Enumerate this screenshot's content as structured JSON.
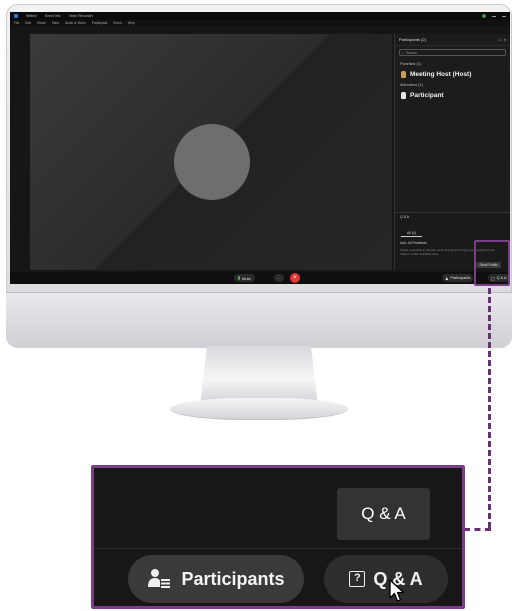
{
  "titlebar": {
    "app": "Webex",
    "tab1": "Event Info",
    "tab2": "Video Recorder"
  },
  "menubar": [
    "File",
    "Edit",
    "Share",
    "View",
    "Audio & Video",
    "Participant",
    "Event",
    "Help"
  ],
  "panel": {
    "header": "Participants (2)",
    "search_placeholder": "Search",
    "panelists_group": "Panelists (1)",
    "host_name": "Meeting Host (Host)",
    "attendees_group": "Attendees (1)",
    "attendee_name": "Participant"
  },
  "qa_pane": {
    "header": "Q & A",
    "tab": "All (0)",
    "ask_label": "Ask:",
    "ask_target": "All Panelists",
    "hint": "Select a panelist in the Ask menu first and then type your question here. There's a 256 character limit.",
    "send_label": "Send Public"
  },
  "controls": {
    "mute_label": "Mute",
    "more_label": "...",
    "end_label": "×",
    "participants_label": "Participants",
    "qa_label": "Q & A"
  },
  "zoom": {
    "tooltip": "Q & A",
    "participants_label": "Participants",
    "qa_label": "Q & A",
    "qa_icon_glyph": "?"
  },
  "icons": {
    "participants": "participants-icon",
    "qa": "question-box-icon",
    "cursor": "mouse-pointer-icon",
    "avatar": "avatar-placeholder"
  },
  "colors": {
    "highlight": "#7b3f8a",
    "connector": "#6a2f77",
    "end_call": "#e23535",
    "screen_bg": "#161616"
  }
}
